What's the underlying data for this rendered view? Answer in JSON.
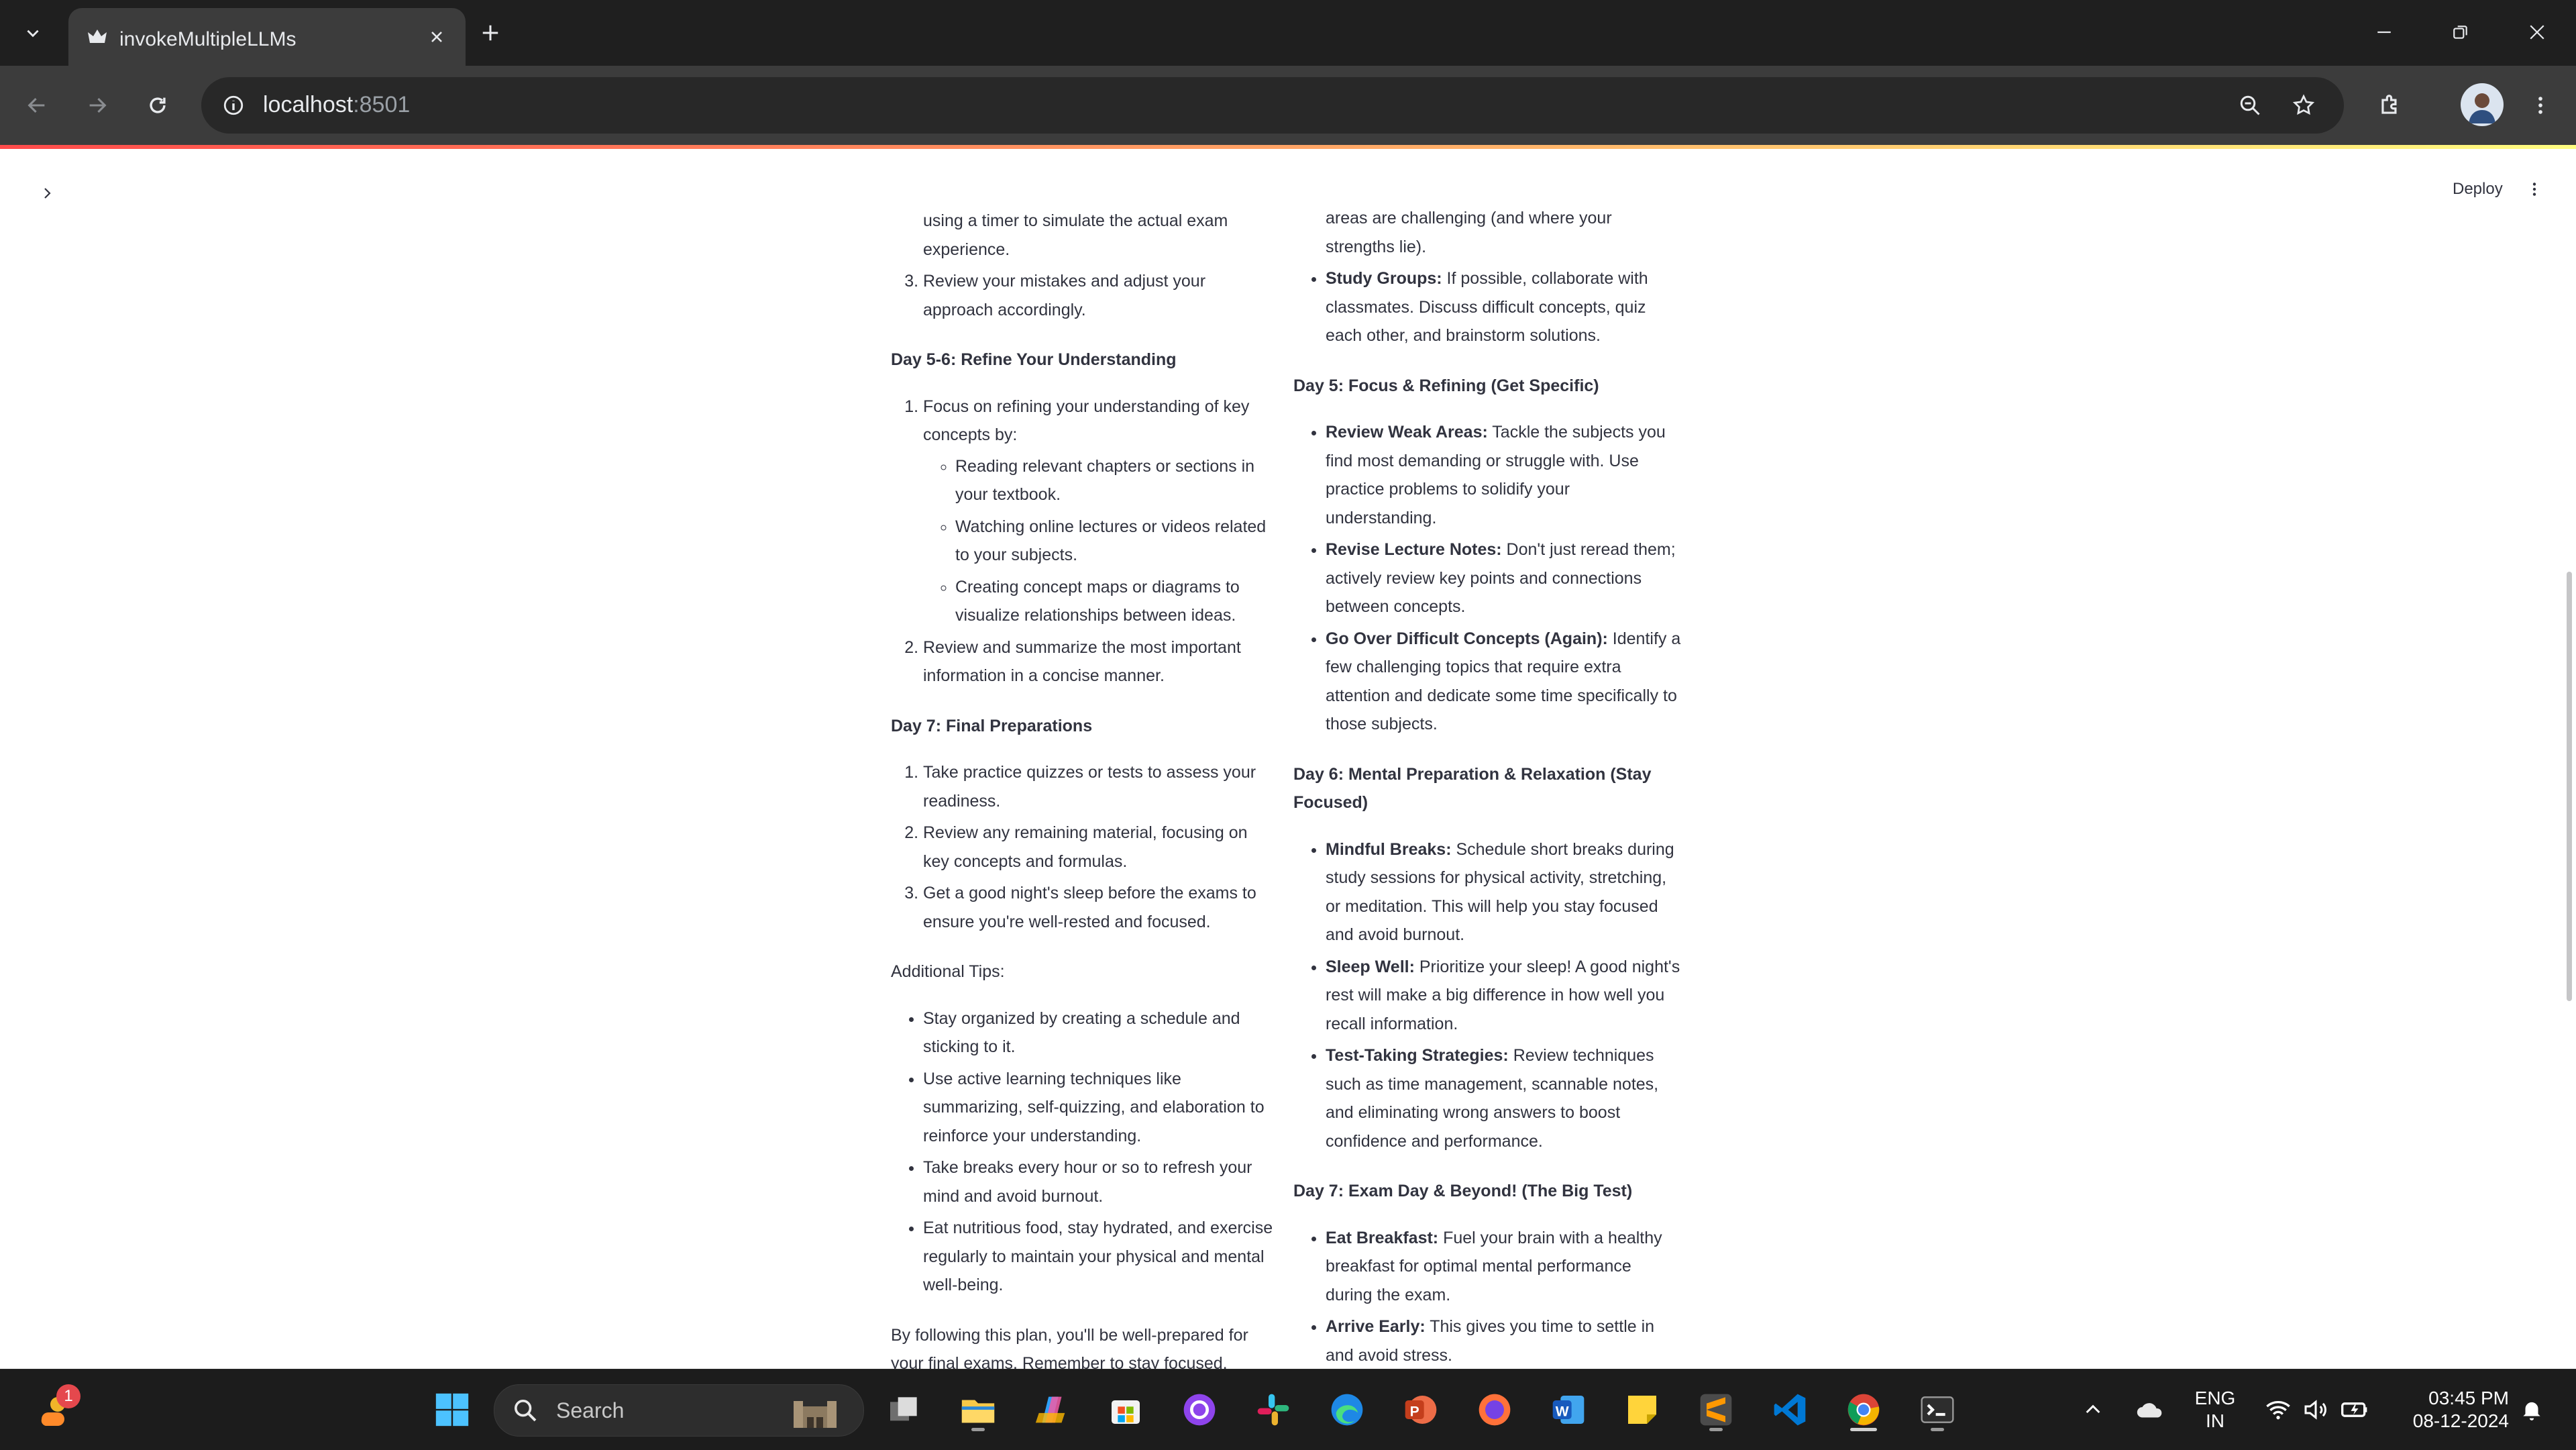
{
  "browser": {
    "tab_title": "invokeMultipleLLMs",
    "url_host": "localhost",
    "url_port": ":8501"
  },
  "app": {
    "deploy_label": "Deploy"
  },
  "content": {
    "left": {
      "cont_line1": "using a timer to simulate the actual exam",
      "cont_line2": "experience.",
      "item3": "Review your mistakes and adjust your approach accordingly.",
      "h_day56": "Day 5-6: Refine Your Understanding",
      "day56_item1": "Focus on refining your understanding of key concepts by:",
      "day56_sub1": "Reading relevant chapters or sections in your textbook.",
      "day56_sub2": "Watching online lectures or videos related to your subjects.",
      "day56_sub3": "Creating concept maps or diagrams to visualize relationships between ideas.",
      "day56_item2": "Review and summarize the most important information in a concise manner.",
      "h_day7": "Day 7: Final Preparations",
      "day7_item1": "Take practice quizzes or tests to assess your readiness.",
      "day7_item2": "Review any remaining material, focusing on key concepts and formulas.",
      "day7_item3": "Get a good night's sleep before the exams to ensure you're well-rested and focused.",
      "additional_tips": "Additional Tips:",
      "tip1": "Stay organized by creating a schedule and sticking to it.",
      "tip2": "Use active learning techniques like summarizing, self-quizzing, and elaboration to reinforce your understanding.",
      "tip3": "Take breaks every hour or so to refresh your mind and avoid burnout.",
      "tip4": "Eat nutritious food, stay hydrated, and exercise regularly to maintain your physical and mental well-being.",
      "closing": "By following this plan, you'll be well-prepared for your final exams. Remember to stay focused,"
    },
    "right": {
      "cont_line1": "areas are challenging (and where your",
      "cont_line2": "strengths lie).",
      "study_groups_b": "Study Groups:",
      "study_groups_t": " If possible, collaborate with classmates. Discuss difficult concepts, quiz each other, and brainstorm solutions.",
      "h_day5": "Day 5: Focus & Refining (Get Specific)",
      "weak_b": "Review Weak Areas:",
      "weak_t": " Tackle the subjects you find most demanding or struggle with. Use practice problems to solidify your understanding.",
      "notes_b": "Revise Lecture Notes:",
      "notes_t": " Don't just reread them; actively review key points and connections between concepts.",
      "difficult_b": "Go Over Difficult Concepts (Again):",
      "difficult_t": " Identify a few challenging topics that require extra attention and dedicate some time specifically to those subjects.",
      "h_day6": "Day 6: Mental Preparation & Relaxation (Stay Focused)",
      "mindful_b": "Mindful Breaks:",
      "mindful_t": " Schedule short breaks during study sessions for physical activity, stretching, or meditation. This will help you stay focused and avoid burnout.",
      "sleep_b": "Sleep Well:",
      "sleep_t": " Prioritize your sleep! A good night's rest will make a big difference in how well you recall information.",
      "test_b": "Test-Taking Strategies:",
      "test_t": " Review techniques such as time management, scannable notes, and eliminating wrong answers to boost confidence and performance.",
      "h_day7": "Day 7: Exam Day & Beyond! (The Big Test)",
      "breakfast_b": "Eat Breakfast:",
      "breakfast_t": " Fuel your brain with a healthy breakfast for optimal mental performance during the exam.",
      "arrive_b": "Arrive Early:",
      "arrive_t": " This gives you time to settle in and avoid stress."
    }
  },
  "taskbar": {
    "notification_count": "1",
    "search_placeholder": "Search",
    "lang_line1": "ENG",
    "lang_line2": "IN",
    "time": "03:45 PM",
    "date": "08-12-2024"
  },
  "colors": {
    "accent_red": "#ff4b4b",
    "text": "#31333f",
    "chrome_dark": "#1f1f1f"
  }
}
